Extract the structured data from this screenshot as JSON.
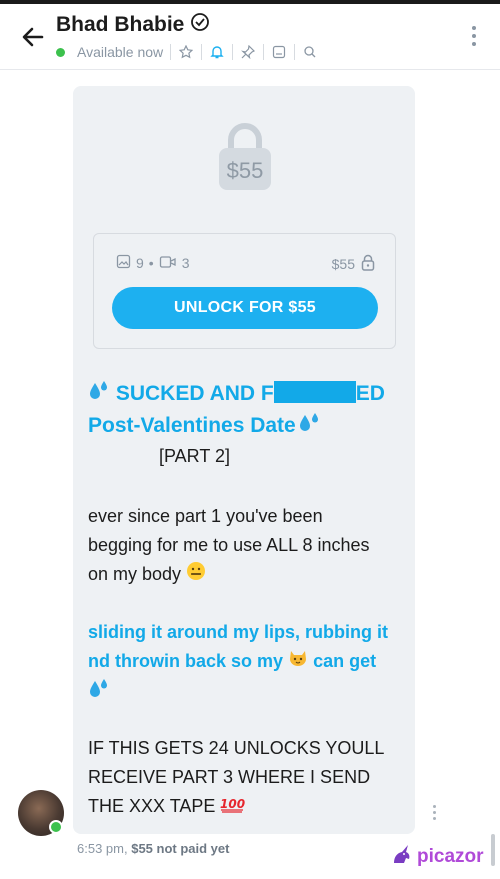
{
  "header": {
    "title": "Bhad Bhabie",
    "status": "Available now"
  },
  "post": {
    "lock_price": "$55",
    "photo_count": "9",
    "bullet": "•",
    "video_count": "3",
    "price": "$55",
    "unlock_label": "UNLOCK FOR $55",
    "title_line1_before": "SUCKED AND F",
    "title_line1_after": "ED",
    "title_line2": "Post-Valentines Date",
    "part": "[PART 2]",
    "para1_l1": "ever since part 1 you've been",
    "para1_l2": "begging for me to use ALL 8 inches",
    "para1_l3": "on my body",
    "para2_l1": "sliding it around my lips, rubbing it",
    "para2_l2_a": "nd throwin back so my",
    "para2_l2_b": "can get",
    "para3_l1": "IF THIS GETS 24 UNLOCKS YOULL",
    "para3_l2": "RECEIVE PART 3 WHERE I SEND",
    "para3_l3": "THE XXX TAPE"
  },
  "meta": {
    "time": "6:53 pm,",
    "paid_status": "$55 not paid yet"
  },
  "watermark": "picazor",
  "colors": {
    "accent": "#1db0f0",
    "online": "#3cc14d"
  }
}
